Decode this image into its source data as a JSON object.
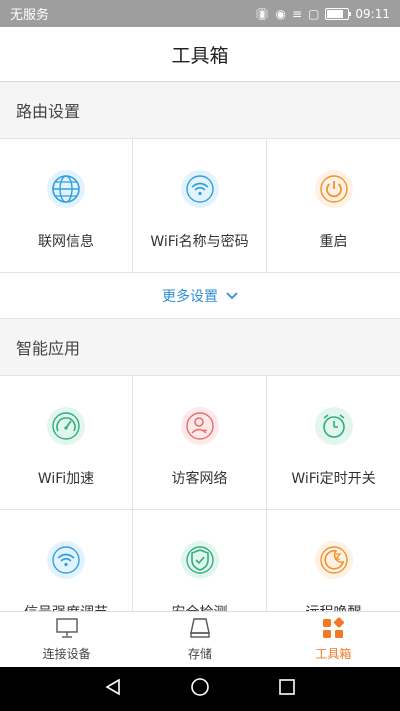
{
  "status_bar": {
    "carrier": "无服务",
    "time": "09:11"
  },
  "title": "工具箱",
  "router_section": {
    "header": "路由设置",
    "items": [
      {
        "label": "联网信息",
        "icon": "globe-icon"
      },
      {
        "label": "WiFi名称与密码",
        "icon": "wifi-icon"
      },
      {
        "label": "重启",
        "icon": "power-icon"
      }
    ],
    "more_label": "更多设置"
  },
  "smart_section": {
    "header": "智能应用",
    "items": [
      {
        "label": "WiFi加速",
        "icon": "speedometer-icon"
      },
      {
        "label": "访客网络",
        "icon": "guest-user-icon"
      },
      {
        "label": "WiFi定时开关",
        "icon": "alarm-clock-icon"
      },
      {
        "label": "信号强度调节",
        "icon": "signal-wifi-icon"
      },
      {
        "label": "安全检测",
        "icon": "shield-check-icon"
      },
      {
        "label": "远程唤醒",
        "icon": "moon-sleep-icon"
      }
    ]
  },
  "tabs": [
    {
      "label": "连接设备",
      "icon": "monitor-icon"
    },
    {
      "label": "存储",
      "icon": "storage-icon"
    },
    {
      "label": "工具箱",
      "icon": "toolbox-grid-icon",
      "active": true
    }
  ],
  "colors": {
    "accent": "#f07a25",
    "link": "#2f8fd2",
    "blue_icon": "#2f9fe0",
    "green_icon": "#2cb07a",
    "red_icon": "#e86b6b",
    "orange_icon": "#f0922e"
  }
}
